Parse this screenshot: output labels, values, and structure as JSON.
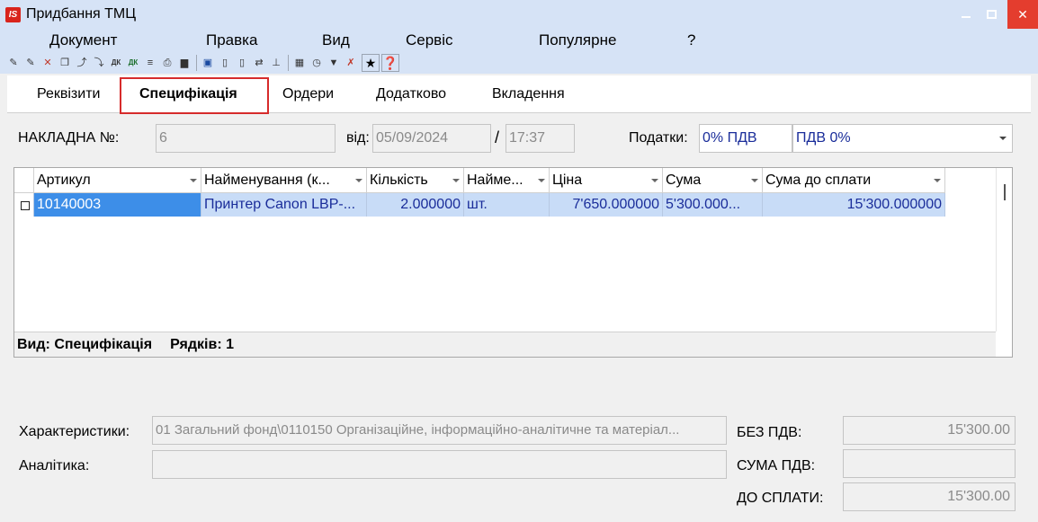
{
  "window": {
    "logo": "IS",
    "title": "Придбання ТМЦ"
  },
  "menu": [
    "Документ",
    "Правка",
    "Вид",
    "Сервіс",
    "Популярне",
    "?"
  ],
  "tabs": [
    {
      "label": "Реквізити"
    },
    {
      "label": "Специфікація"
    },
    {
      "label": "Ордери"
    },
    {
      "label": "Додатково"
    },
    {
      "label": "Вкладення"
    }
  ],
  "header": {
    "invoice_label": "НАКЛАДНА №:",
    "invoice_number": "6",
    "from_label": "від:",
    "date": "05/09/2024",
    "time_separator": "/",
    "time": "17:37",
    "tax_label": "Податки:",
    "tax_code": "0% ПДВ",
    "tax_name": "ПДВ 0%"
  },
  "table": {
    "columns": [
      "Артикул",
      "Найменування (к...",
      "Кількість",
      "Найме...",
      "Ціна",
      "Сума",
      "Сума до сплати"
    ],
    "rows": [
      {
        "article": "10140003",
        "name": "Принтер Canon LBP-...",
        "quantity": "2.000000",
        "unit": "шт.",
        "price": "7'650.000000",
        "sum": "5'300.000...",
        "sum_to_pay": "15'300.000000"
      }
    ],
    "status_view": "Вид: Специфікація",
    "status_rows": "Рядків: 1"
  },
  "footer": {
    "characteristics_label": "Характеристики:",
    "characteristics_value": "01 Загальний фонд\\0110150 Організаційне, інформаційно-аналітичне та матеріал...",
    "analytics_label": "Аналітика:",
    "analytics_value": "",
    "no_vat_label": "БЕЗ ПДВ:",
    "no_vat_value": "15'300.00",
    "vat_sum_label": "СУМА ПДВ:",
    "vat_sum_value": "",
    "to_pay_label": "ДО СПЛАТИ:",
    "to_pay_value": "15'300.00"
  },
  "colors": {
    "titlebar": "#d6e3f6",
    "accent": "#3d8ee8",
    "row_selection": "#c8dcf7",
    "close_button": "#e43d2e",
    "tab_highlight": "#d62b2b"
  },
  "icons": [
    "new-doc-icon",
    "new-copy-icon",
    "delete-icon",
    "copy-icon",
    "export-icon",
    "import-icon",
    "debit-credit-icon",
    "debit-credit-2-icon",
    "filter-list-icon",
    "print-icon",
    "archive-icon",
    "save-icon",
    "book-open-icon",
    "book-icon",
    "replace-icon",
    "tree-icon",
    "table-icon",
    "history-icon",
    "filter-icon",
    "clear-filter-icon",
    "favorites-icon",
    "help-icon"
  ]
}
